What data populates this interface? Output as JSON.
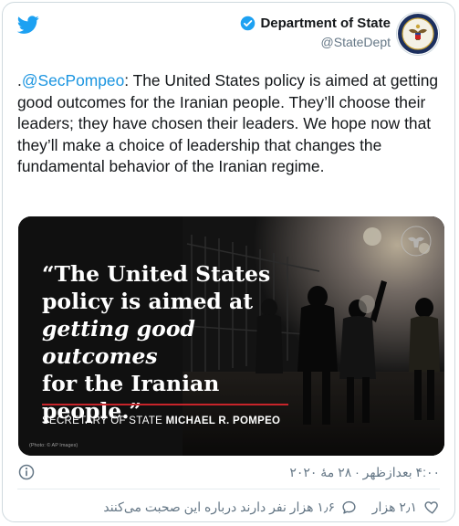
{
  "author": {
    "name": "Department of State",
    "handle": "@StateDept"
  },
  "tweet": {
    "prefix": ".",
    "mention": "@SecPompeo",
    "body": ": The United States policy is aimed at getting good outcomes for the Iranian people.  They’ll choose their leaders; they have chosen their leaders. We hope now that they’ll make a choice of leadership that changes the fundamental behavior of the Iranian regime."
  },
  "media": {
    "quote_line1": "“The United States",
    "quote_line2": "policy is aimed at",
    "quote_line3": "getting good outcomes",
    "quote_line4": "for the Iranian people.”",
    "title_prefix": "SECRETARY OF STATE ",
    "title_name": "MICHAEL R. POMPEO",
    "credit": "(Photo: © AP Images)"
  },
  "meta": {
    "timestamp": "۴:۰۰ بعدازظهر · ۲۸ مهٔ ۲۰۲۰"
  },
  "actions": {
    "likes": "۲٫۱ هزار",
    "comments": "۱٫۶ هزار نفر دارند درباره این صحبت می‌کنند"
  },
  "colors": {
    "twitter_blue": "#1da1f2",
    "link": "#1b95e0",
    "muted": "#657786"
  }
}
